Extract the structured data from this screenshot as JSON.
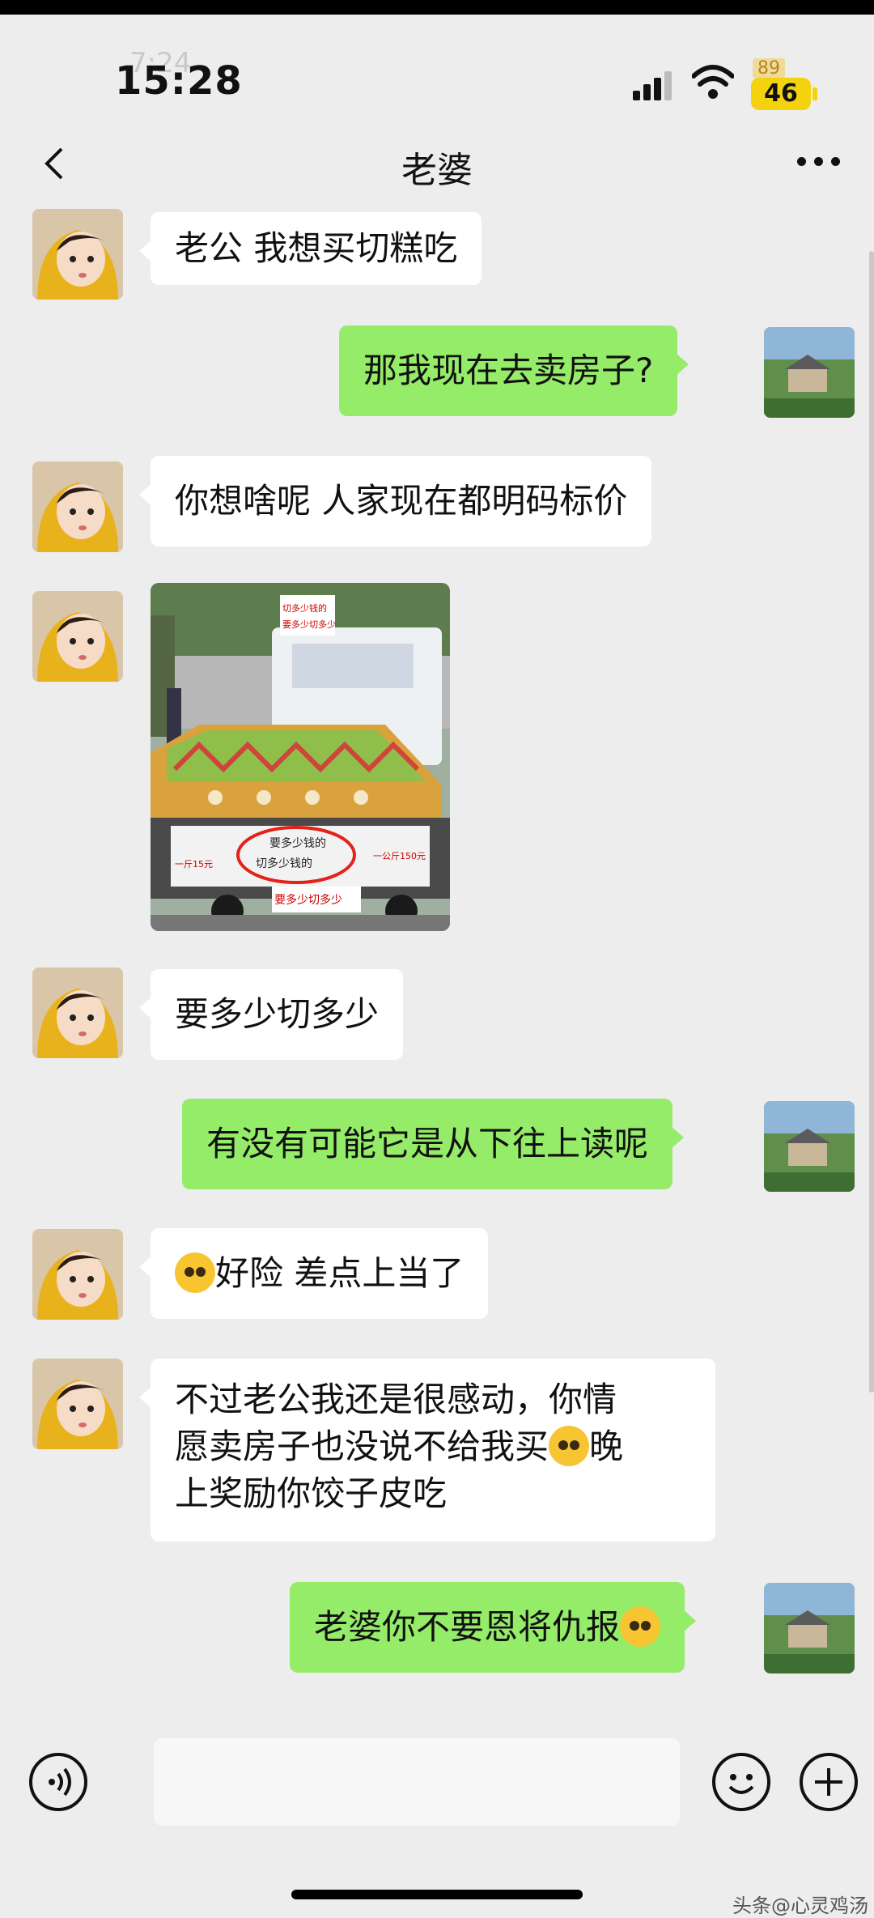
{
  "status_bar": {
    "time": "15:28",
    "ghost_time": "7:24",
    "battery_level": "46",
    "ghost_battery": "89"
  },
  "chat": {
    "title": "老婆",
    "messages": [
      {
        "sender": "her",
        "text": "老公 我想买切糕吃"
      },
      {
        "sender": "me",
        "text": "那我现在去卖房子?"
      },
      {
        "sender": "her",
        "text": "你想啥呢 人家现在都明码标价"
      },
      {
        "sender": "her",
        "type": "image",
        "sign_texts": [
          "要多少钱的",
          "切多少钱的",
          "要多少切多少",
          "一斤15元",
          "一公斤150元",
          "切多少"
        ]
      },
      {
        "sender": "her",
        "text": "要多少切多少"
      },
      {
        "sender": "me",
        "text": "有没有可能它是从下往上读呢"
      },
      {
        "sender": "her",
        "text": "好险 差点上当了",
        "emoji": "flushed-face"
      },
      {
        "sender": "her",
        "text_lines": [
          "不过老公我还是很感动，你情",
          "愿卖房子也没说不给我买",
          "晚",
          "上奖励你饺子皮吃"
        ],
        "emoji": "relieved-face"
      },
      {
        "sender": "me",
        "text": "老婆你不要恩将仇报",
        "emoji": "pleading-face"
      }
    ]
  },
  "input_bar": {
    "icons": [
      "voice-icon",
      "emoji-icon",
      "plus-icon"
    ]
  },
  "watermark": "头条@心灵鸡汤"
}
